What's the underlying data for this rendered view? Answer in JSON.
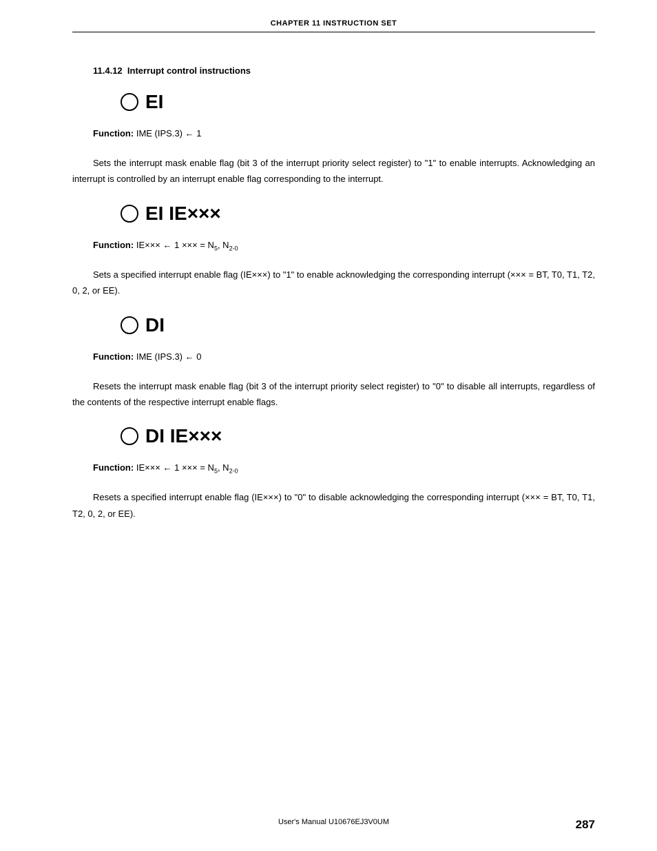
{
  "header": "CHAPTER 11   INSTRUCTION SET",
  "section": {
    "number": "11.4.12",
    "title": "Interrupt control instructions"
  },
  "instructions": [
    {
      "mnemonic": "EI",
      "param": "",
      "function_label": "Function:",
      "function_html": "IME (IPS.3) ← 1",
      "desc_html": "Sets the interrupt mask enable flag (bit 3 of the interrupt priority select register) to \"1\" to enable interrupts. Acknowledging an interrupt is controlled by an interrupt enable flag corresponding to the interrupt."
    },
    {
      "mnemonic": "EI IE",
      "param": "×××",
      "function_label": "Function:",
      "function_html": "IE××× ← 1  ××× = N<span class=\"sub\">5</span>, N<span class=\"sub\">2-0</span>",
      "desc_html": "Sets a specified interrupt enable flag (IE×××) to \"1\" to enable acknowledging the corresponding interrupt (××× = BT, T0, T1, T2, 0, 2, or EE)."
    },
    {
      "mnemonic": "DI",
      "param": "",
      "function_label": "Function:",
      "function_html": "IME (IPS.3) ← 0",
      "desc_html": "Resets the interrupt mask enable flag (bit 3 of the interrupt priority select register) to \"0\" to disable all interrupts, regardless of the contents of the respective interrupt enable flags."
    },
    {
      "mnemonic": "DI IE",
      "param": "×××",
      "function_label": "Function:",
      "function_html": "IE××× ← 1  ××× = N<span class=\"sub\">5</span>, N<span class=\"sub\">2-0</span>",
      "desc_html": "Resets a specified interrupt enable flag (IE×××) to \"0\" to disable acknowledging the corresponding interrupt (××× = BT, T0, T1, T2, 0, 2, or EE)."
    }
  ],
  "footer": {
    "manual": "User's Manual  U10676EJ3V0UM",
    "page": "287"
  }
}
